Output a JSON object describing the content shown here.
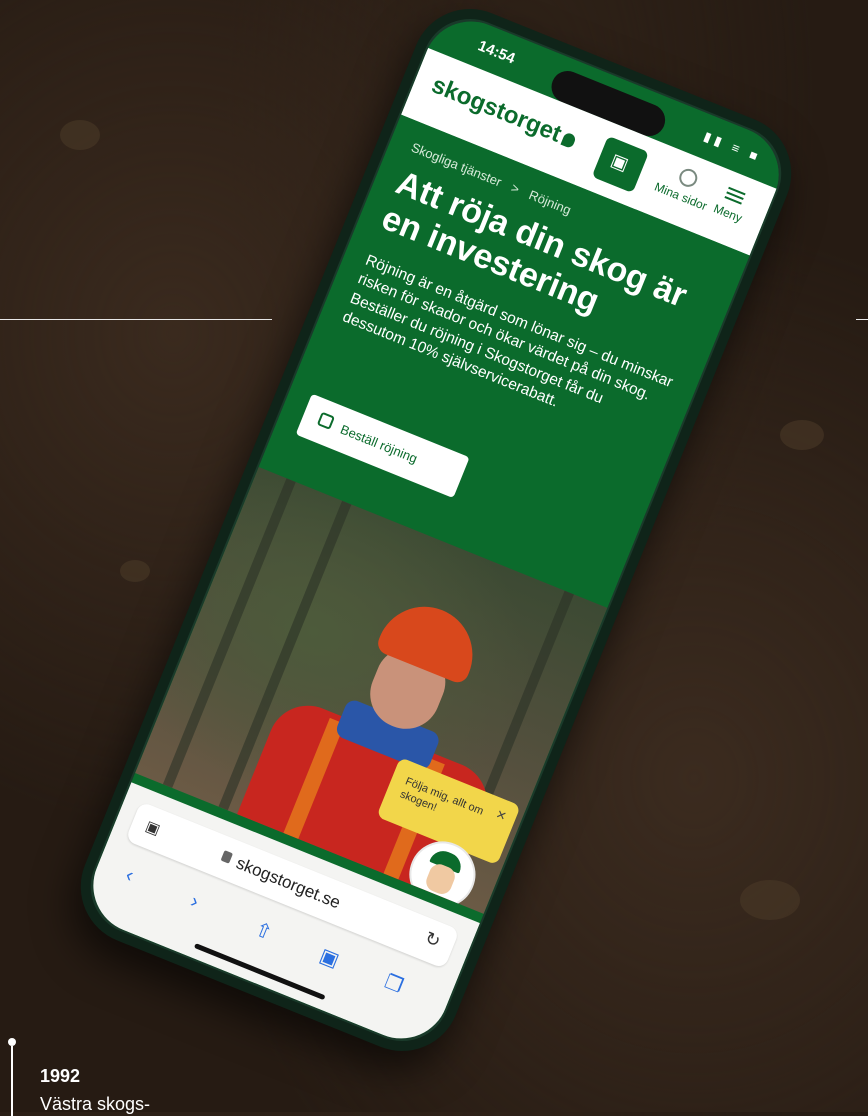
{
  "status": {
    "time": "14:54",
    "icons": "▮▮ ≡ ■"
  },
  "header": {
    "logo": "skogstorget",
    "mina_sidor": "Mina sidor",
    "meny": "Meny"
  },
  "breadcrumb": {
    "parent": "Skogliga tjänster",
    "separator": ">",
    "current": "Röjning"
  },
  "hero": {
    "title": "Att röja din skog är en investering",
    "text": "Röjning är en åtgärd som lönar sig – du minskar risken för skador och ökar värdet på din skog. Beställer du röjning i Skogstorget får du dessutom 10% självservicerabatt.",
    "order_button": "Beställ röjning"
  },
  "popup": {
    "text": "Följa mig, allt om skogen!",
    "close": "×"
  },
  "browser": {
    "aa": "▣",
    "url": "skogstorget.se",
    "reload": "↻"
  },
  "caption": {
    "year": "1992",
    "text": "Västra skogs-"
  },
  "colors": {
    "brand_green": "#0b6b2c",
    "popup_yellow": "#f2d64a",
    "soil": "#261b13"
  }
}
